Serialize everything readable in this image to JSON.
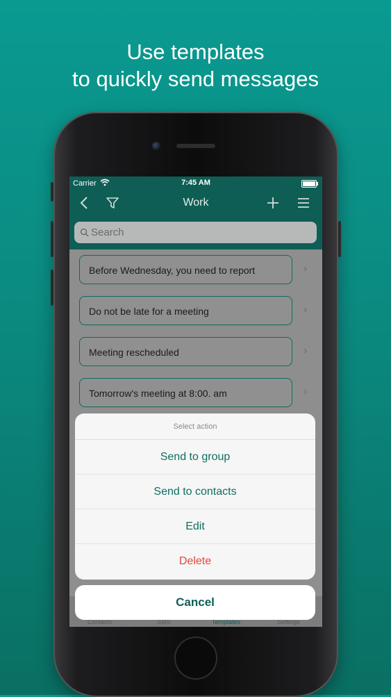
{
  "headline": {
    "line1": "Use templates",
    "line2": "to quickly send messages"
  },
  "status_bar": {
    "carrier": "Carrier",
    "time": "7:45 AM"
  },
  "nav_bar": {
    "title": "Work",
    "icons": [
      "back-icon",
      "filter-icon",
      "add-icon",
      "menu-icon"
    ]
  },
  "search": {
    "placeholder": "Search"
  },
  "templates": [
    {
      "text": "Before Wednesday, you need to report"
    },
    {
      "text": "Do not be late for a meeting"
    },
    {
      "text": "Meeting rescheduled"
    },
    {
      "text": "Tomorrow's meeting at 8:00. am"
    }
  ],
  "tab_bar": {
    "tabs": [
      "Contacts",
      "SMS",
      "Templates",
      "Settings"
    ],
    "active": "Templates"
  },
  "action_sheet": {
    "title": "Select action",
    "actions": [
      {
        "label": "Send to group"
      },
      {
        "label": "Send to contacts"
      },
      {
        "label": "Edit"
      },
      {
        "label": "Delete"
      }
    ],
    "cancel_label": "Cancel"
  },
  "colors": {
    "background": "#0a9a91",
    "nav": "#0f5e55",
    "accent": "#0f6e62",
    "danger": "#e0473a"
  }
}
